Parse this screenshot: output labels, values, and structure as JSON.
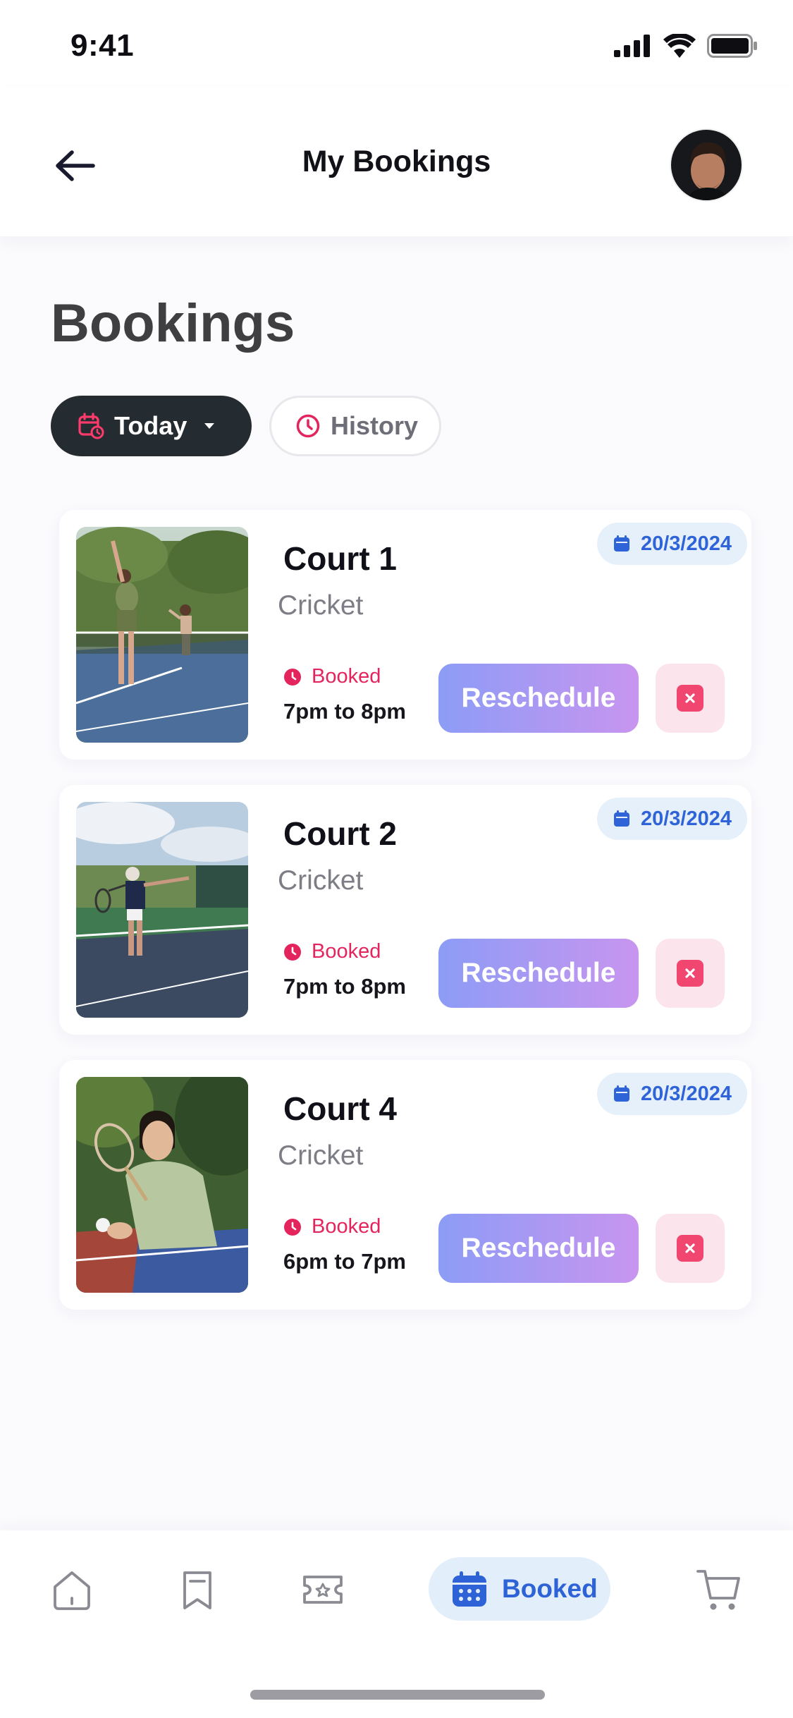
{
  "status_bar": {
    "time": "9:41"
  },
  "header": {
    "title": "My Bookings"
  },
  "page": {
    "heading": "Bookings"
  },
  "filters": {
    "today_label": "Today",
    "history_label": "History"
  },
  "bookings": [
    {
      "court": "Court 1",
      "sport": "Cricket",
      "date": "20/3/2024",
      "status": "Booked",
      "time": "7pm to 8pm",
      "reschedule_label": "Reschedule"
    },
    {
      "court": "Court 2",
      "sport": "Cricket",
      "date": "20/3/2024",
      "status": "Booked",
      "time": "7pm to 8pm",
      "reschedule_label": "Reschedule"
    },
    {
      "court": "Court 4",
      "sport": "Cricket",
      "date": "20/3/2024",
      "status": "Booked",
      "time": "6pm to 7pm",
      "reschedule_label": "Reschedule"
    }
  ],
  "bottom_nav": {
    "items": [
      {
        "icon": "home-icon"
      },
      {
        "icon": "bookmark-icon"
      },
      {
        "icon": "ticket-icon"
      },
      {
        "icon": "calendar-icon",
        "label": "Booked",
        "active": true
      },
      {
        "icon": "cart-icon"
      }
    ]
  },
  "colors": {
    "accent": "#2d63d6",
    "booked_status": "#e3245d",
    "reschedule_gradient_start": "#8c9cf6",
    "reschedule_gradient_end": "#c895ef",
    "chip_dark": "#242b31"
  }
}
